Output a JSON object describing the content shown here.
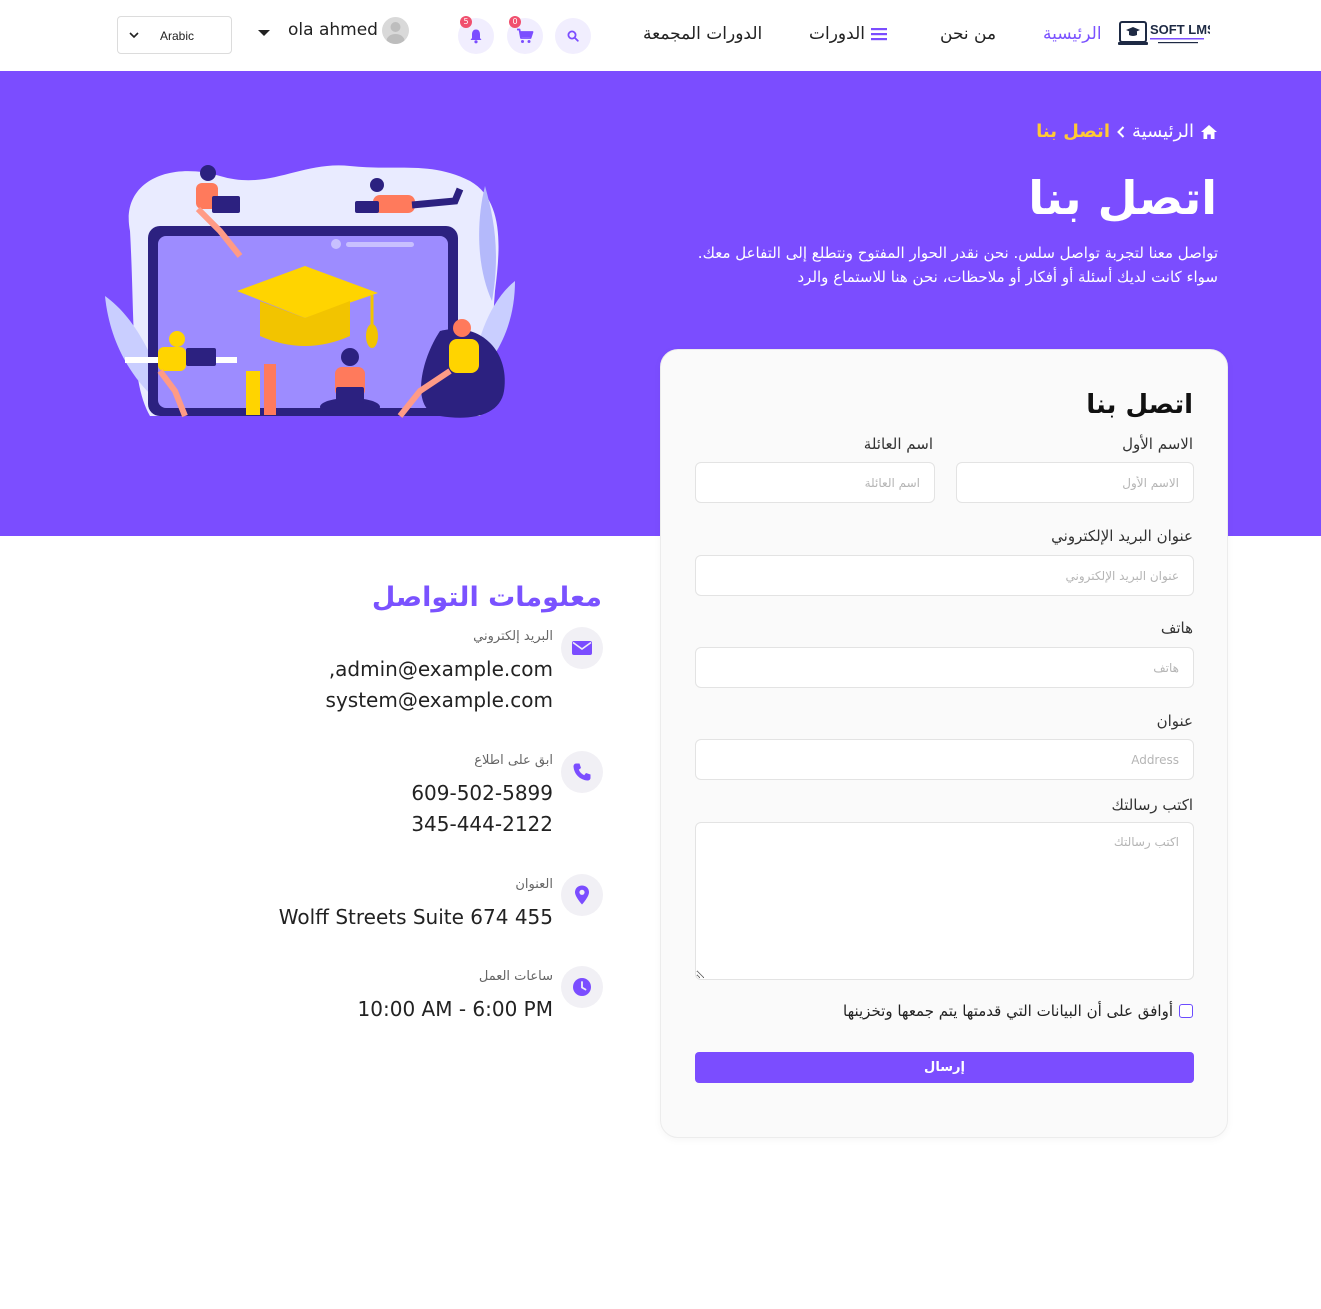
{
  "header": {
    "language": "Arabic",
    "user_name": "ola ahmed",
    "notifications_count": "5",
    "cart_count": "0",
    "nav": {
      "home": "الرئيسية",
      "about": "من نحن",
      "courses": "الدورات",
      "bundles": "الدورات المجمعة"
    },
    "logo_text": "SOFT LMS"
  },
  "hero": {
    "breadcrumb_home": "الرئيسية",
    "breadcrumb_current": "اتصل بنا",
    "title": "اتصل بنا",
    "desc_line1": "تواصل معنا لتجربة تواصل سلس. نحن نقدر الحوار المفتوح ونتطلع إلى التفاعل معك.",
    "desc_line2": "سواء كانت لديك أسئلة أو أفكار أو ملاحظات، نحن هنا للاستماع والرد"
  },
  "contact_info": {
    "title": "معلومات التواصل",
    "email_label": "البريد إلكتروني",
    "email_1": ",admin@example.com",
    "email_2": "system@example.com",
    "phone_label": "ابق على اطلاع",
    "phone_1": "609-502-5899",
    "phone_2": "345-444-2122",
    "address_label": "العنوان",
    "address": "Wolff Streets Suite 674 455",
    "hours_label": "ساعات العمل",
    "hours": "10:00 AM - 6:00 PM"
  },
  "form": {
    "title": "اتصل بنا",
    "first_name_label": "الاسم الأول",
    "first_name_placeholder": "الاسم الأول",
    "last_name_label": "اسم العائلة",
    "last_name_placeholder": "اسم العائلة",
    "email_label": "عنوان البريد الإلكتروني",
    "email_placeholder": "عنوان البريد الإلكتروني",
    "phone_label": "هاتف",
    "phone_placeholder": "هاتف",
    "address_label": "عنوان",
    "address_placeholder": "Address",
    "message_label": "اكتب رسالتك",
    "message_placeholder": "اكتب رسالتك",
    "consent": "أوافق على أن البيانات التي قدمتها يتم جمعها وتخزينها",
    "submit": "إرسال"
  },
  "colors": {
    "primary": "#7b4dff",
    "accent_yellow": "#ffc935",
    "badge": "#f0506e"
  }
}
